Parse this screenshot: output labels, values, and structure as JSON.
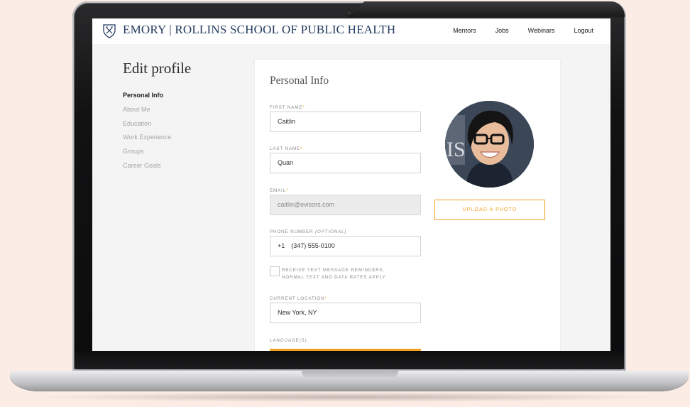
{
  "header": {
    "brand": "EMORY | ROLLINS SCHOOL OF PUBLIC HEALTH",
    "nav": [
      "Mentors",
      "Jobs",
      "Webinars",
      "Logout"
    ]
  },
  "page": {
    "title": "Edit profile"
  },
  "side_menu": {
    "items": [
      "Personal Info",
      "About Me",
      "Education",
      "Work Experience",
      "Groups",
      "Career Goals"
    ],
    "active": "Personal Info"
  },
  "form": {
    "title": "Personal Info",
    "first_name": {
      "label": "First Name",
      "required_mark": "*",
      "value": "Caitlin"
    },
    "last_name": {
      "label": "Last Name",
      "required_mark": "*",
      "value": "Quan"
    },
    "email": {
      "label": "Email",
      "required_mark": "*",
      "value": "caitlin@evisors.com"
    },
    "phone": {
      "label": "Phone Number",
      "optional_text": "(Optional)",
      "country_code": "+1",
      "value": "(347) 555-0100"
    },
    "sms_checkbox": {
      "line1": "Receive text message reminders.",
      "line2": "Normal text and data rates apply.",
      "checked": false
    },
    "location": {
      "label": "Current Location",
      "required_mark": "*",
      "value": "New York, NY"
    },
    "languages": {
      "label": "Language(s)"
    }
  },
  "photo": {
    "upload_label": "Upload a photo"
  },
  "colors": {
    "accent": "#f4a21e",
    "brand_navy": "#223a5e"
  }
}
